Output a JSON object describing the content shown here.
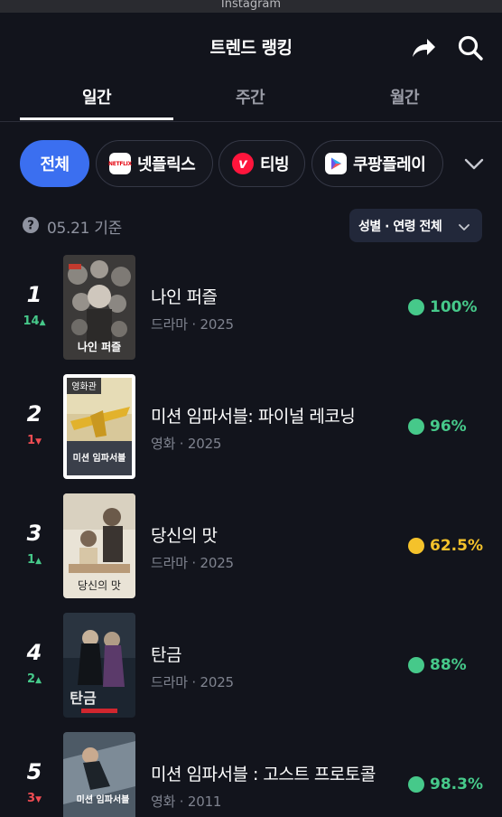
{
  "status_bar": {
    "app_name": "Instagram"
  },
  "header": {
    "title": "트렌드 랭킹",
    "share_icon": "share-icon",
    "search_icon": "search-icon"
  },
  "tabs": [
    {
      "label": "일간",
      "active": true
    },
    {
      "label": "주간",
      "active": false
    },
    {
      "label": "월간",
      "active": false
    }
  ],
  "platform_chips": [
    {
      "label": "전체",
      "active": true
    },
    {
      "label": "넷플릭스",
      "active": false,
      "logo_text": "NETFLIX",
      "logo_color": "#e50914"
    },
    {
      "label": "티빙",
      "active": false,
      "logo_text": "v",
      "logo_color": "#ff153c"
    },
    {
      "label": "쿠팡플레이",
      "active": false,
      "logo_color": "#ffffff"
    }
  ],
  "date_info": {
    "text": "05.21 기준"
  },
  "filter": {
    "label": "성별 · 연령 전체"
  },
  "colors": {
    "accent": "#3b6ff0",
    "score_high": "#46c98a",
    "score_mid": "#f4c22b",
    "rank_up": "#46c98a",
    "rank_down": "#ef4c52"
  },
  "rankings": [
    {
      "rank": "1",
      "change": "14",
      "direction": "up",
      "arrow": "▲",
      "title": "나인 퍼즐",
      "meta": "드라마 · 2025",
      "score": "100%",
      "score_level": "high",
      "poster_badge": "",
      "poster_title": "나인 퍼즐"
    },
    {
      "rank": "2",
      "change": "1",
      "direction": "down",
      "arrow": "▼",
      "title": "미션 임파서블: 파이널 레코닝",
      "meta": "영화 · 2025",
      "score": "96%",
      "score_level": "high",
      "poster_badge": "영화관",
      "poster_title": "미션 임파서블"
    },
    {
      "rank": "3",
      "change": "1",
      "direction": "up",
      "arrow": "▲",
      "title": "당신의 맛",
      "meta": "드라마 · 2025",
      "score": "62.5%",
      "score_level": "mid",
      "poster_badge": "",
      "poster_title": "당신의 맛"
    },
    {
      "rank": "4",
      "change": "2",
      "direction": "up",
      "arrow": "▲",
      "title": "탄금",
      "meta": "드라마 · 2025",
      "score": "88%",
      "score_level": "high",
      "poster_badge": "",
      "poster_title": "탄금"
    },
    {
      "rank": "5",
      "change": "3",
      "direction": "down",
      "arrow": "▼",
      "title": "미션 임파서블 : 고스트 프로토콜",
      "meta": "영화 · 2011",
      "score": "98.3%",
      "score_level": "high",
      "poster_badge": "",
      "poster_title": "미션 임파서블"
    }
  ]
}
